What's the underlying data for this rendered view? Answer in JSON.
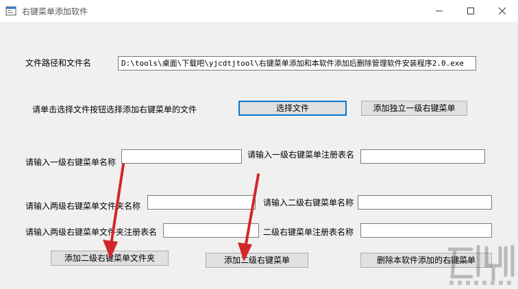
{
  "window": {
    "title": "右键菜单添加软件"
  },
  "path_section": {
    "label": "文件路径和文件名",
    "value": "D:\\tools\\桌面\\下载吧\\yjcdtjtool\\右键菜单添加和本软件添加后删除管理软件安装程序2.0.exe"
  },
  "select_section": {
    "hint": "请单击选择文件按钮选择添加右键菜单的文件",
    "select_file_button": "选择文件",
    "add_standalone_button": "添加独立一级右键菜单"
  },
  "form": {
    "level1_name_label": "请输入一级右键菜单名称",
    "level1_reg_label": "请输入一级右键菜单注册表名",
    "level2_folder_name_label": "请输入两级右键菜单文件夹名称",
    "level2_name_label": "请输入二级右键菜单名称",
    "level2_folder_reg_label": "请输入两级右键菜单文件夹注册表名",
    "level2_reg_label": "二级右键菜单注册表名称"
  },
  "actions": {
    "add_level2_folder_button": "添加二级右键菜单文件夹",
    "add_level2_menu_button": "添加二级右键菜单",
    "delete_added_button": "删除本软件添加的右键菜单"
  },
  "colors": {
    "arrow": "#d3262b",
    "focus": "#0078d7"
  }
}
